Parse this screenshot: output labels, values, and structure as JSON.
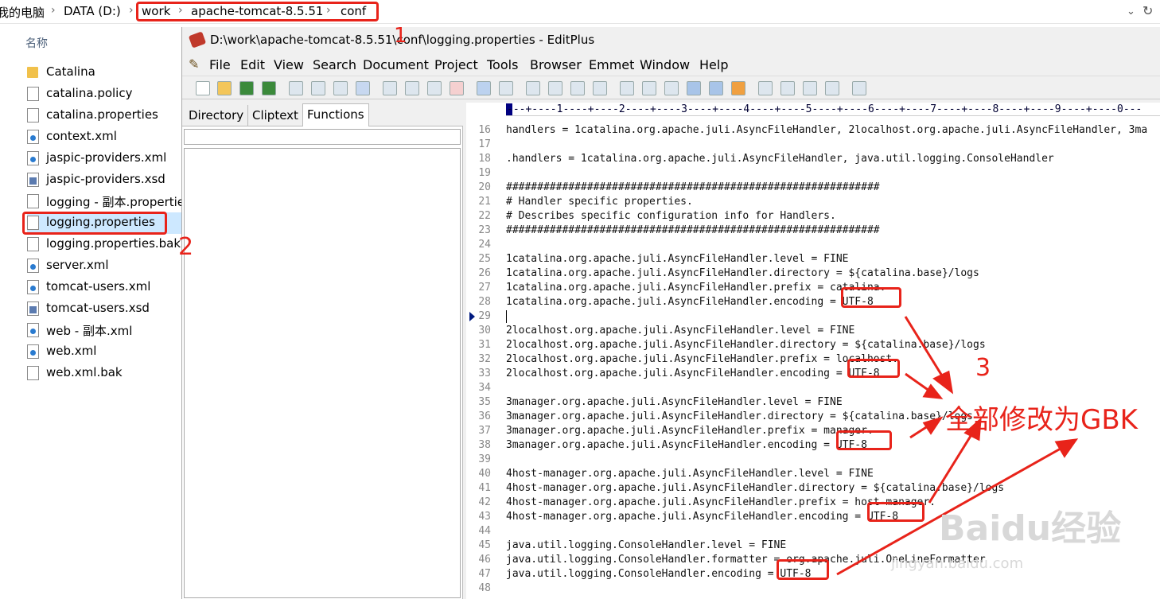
{
  "addressbar": {
    "root": "我的电脑",
    "drive": "DATA (D:)",
    "crumbs": [
      "work",
      "apache-tomcat-8.5.51",
      "conf"
    ],
    "sep": "›"
  },
  "explorer": {
    "column_header": "名称",
    "items": [
      {
        "name": "Catalina",
        "icon": "folder-icon"
      },
      {
        "name": "catalina.policy",
        "icon": "file-icon"
      },
      {
        "name": "catalina.properties",
        "icon": "file-icon"
      },
      {
        "name": "context.xml",
        "icon": "xml-file-icon"
      },
      {
        "name": "jaspic-providers.xml",
        "icon": "xml-file-icon"
      },
      {
        "name": "jaspic-providers.xsd",
        "icon": "xsd-file-icon"
      },
      {
        "name": "logging - 副本.properties",
        "icon": "file-icon"
      },
      {
        "name": "logging.properties",
        "icon": "file-icon"
      },
      {
        "name": "logging.properties.bak",
        "icon": "file-icon"
      },
      {
        "name": "server.xml",
        "icon": "xml-file-icon"
      },
      {
        "name": "tomcat-users.xml",
        "icon": "xml-file-icon"
      },
      {
        "name": "tomcat-users.xsd",
        "icon": "xsd-file-icon"
      },
      {
        "name": "web - 副本.xml",
        "icon": "xml-file-icon"
      },
      {
        "name": "web.xml",
        "icon": "xml-file-icon"
      },
      {
        "name": "web.xml.bak",
        "icon": "file-icon"
      }
    ]
  },
  "editplus": {
    "title": "D:\\work\\apache-tomcat-8.5.51\\conf\\logging.properties - EditPlus",
    "menu": [
      "File",
      "Edit",
      "View",
      "Search",
      "Document",
      "Project",
      "Tools",
      "Browser",
      "Emmet",
      "Window",
      "Help"
    ],
    "panel_tabs": [
      "Directory",
      "Cliptext",
      "Functions"
    ],
    "active_tab": "Functions",
    "ruler": "---+----1----+----2----+----3----+----4----+----5----+----6----+----7----+----8----+----9----+----0---",
    "lines": [
      {
        "n": "16",
        "t": "handlers = 1catalina.org.apache.juli.AsyncFileHandler, 2localhost.org.apache.juli.AsyncFileHandler, 3ma"
      },
      {
        "n": "17",
        "t": ""
      },
      {
        "n": "18",
        "t": ".handlers = 1catalina.org.apache.juli.AsyncFileHandler, java.util.logging.ConsoleHandler"
      },
      {
        "n": "19",
        "t": ""
      },
      {
        "n": "20",
        "t": "############################################################"
      },
      {
        "n": "21",
        "t": "# Handler specific properties."
      },
      {
        "n": "22",
        "t": "# Describes specific configuration info for Handlers."
      },
      {
        "n": "23",
        "t": "############################################################"
      },
      {
        "n": "24",
        "t": ""
      },
      {
        "n": "25",
        "t": "1catalina.org.apache.juli.AsyncFileHandler.level = FINE"
      },
      {
        "n": "26",
        "t": "1catalina.org.apache.juli.AsyncFileHandler.directory = ${catalina.base}/logs"
      },
      {
        "n": "27",
        "t": "1catalina.org.apache.juli.AsyncFileHandler.prefix = catalina."
      },
      {
        "n": "28",
        "t": "1catalina.org.apache.juli.AsyncFileHandler.encoding = UTF-8"
      },
      {
        "n": "29",
        "t": ""
      },
      {
        "n": "30",
        "t": "2localhost.org.apache.juli.AsyncFileHandler.level = FINE"
      },
      {
        "n": "31",
        "t": "2localhost.org.apache.juli.AsyncFileHandler.directory = ${catalina.base}/logs"
      },
      {
        "n": "32",
        "t": "2localhost.org.apache.juli.AsyncFileHandler.prefix = localhost."
      },
      {
        "n": "33",
        "t": "2localhost.org.apache.juli.AsyncFileHandler.encoding = UTF-8"
      },
      {
        "n": "34",
        "t": ""
      },
      {
        "n": "35",
        "t": "3manager.org.apache.juli.AsyncFileHandler.level = FINE"
      },
      {
        "n": "36",
        "t": "3manager.org.apache.juli.AsyncFileHandler.directory = ${catalina.base}/logs"
      },
      {
        "n": "37",
        "t": "3manager.org.apache.juli.AsyncFileHandler.prefix = manager."
      },
      {
        "n": "38",
        "t": "3manager.org.apache.juli.AsyncFileHandler.encoding = UTF-8"
      },
      {
        "n": "39",
        "t": ""
      },
      {
        "n": "40",
        "t": "4host-manager.org.apache.juli.AsyncFileHandler.level = FINE"
      },
      {
        "n": "41",
        "t": "4host-manager.org.apache.juli.AsyncFileHandler.directory = ${catalina.base}/logs"
      },
      {
        "n": "42",
        "t": "4host-manager.org.apache.juli.AsyncFileHandler.prefix = host-manager."
      },
      {
        "n": "43",
        "t": "4host-manager.org.apache.juli.AsyncFileHandler.encoding = UTF-8"
      },
      {
        "n": "44",
        "t": ""
      },
      {
        "n": "45",
        "t": "java.util.logging.ConsoleHandler.level = FINE"
      },
      {
        "n": "46",
        "t": "java.util.logging.ConsoleHandler.formatter = org.apache.juli.OneLineFormatter"
      },
      {
        "n": "47",
        "t": "java.util.logging.ConsoleHandler.encoding = UTF-8"
      },
      {
        "n": "48",
        "t": ""
      }
    ]
  },
  "annotations": {
    "step1": "1",
    "step2": "2",
    "step3": "3",
    "instruction": "全部修改为GBK",
    "color": "#e8231a"
  },
  "watermark": {
    "brand": "Baidu经验",
    "url": "jingyan.baidu.com"
  }
}
